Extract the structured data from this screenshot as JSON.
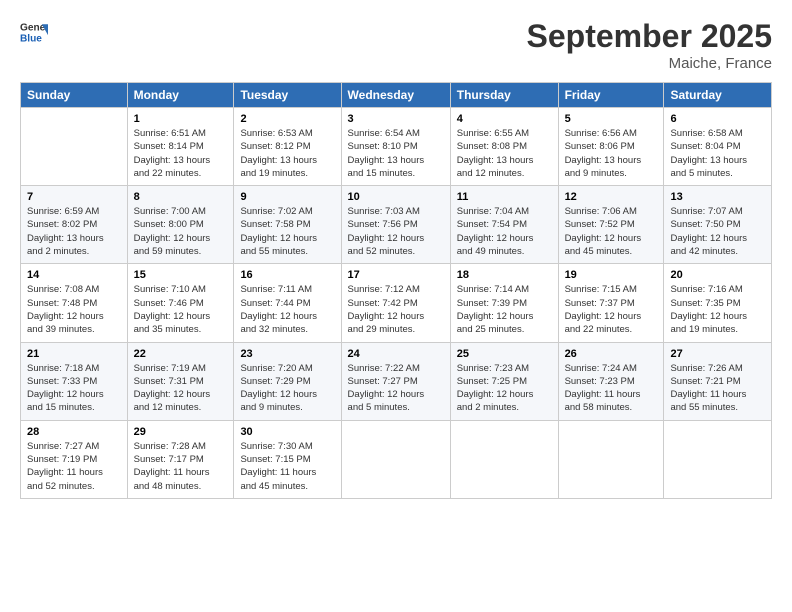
{
  "header": {
    "logo_line1": "General",
    "logo_line2": "Blue",
    "month_title": "September 2025",
    "location": "Maiche, France"
  },
  "columns": [
    "Sunday",
    "Monday",
    "Tuesday",
    "Wednesday",
    "Thursday",
    "Friday",
    "Saturday"
  ],
  "weeks": [
    [
      {
        "day": "",
        "detail": ""
      },
      {
        "day": "1",
        "detail": "Sunrise: 6:51 AM\nSunset: 8:14 PM\nDaylight: 13 hours\nand 22 minutes."
      },
      {
        "day": "2",
        "detail": "Sunrise: 6:53 AM\nSunset: 8:12 PM\nDaylight: 13 hours\nand 19 minutes."
      },
      {
        "day": "3",
        "detail": "Sunrise: 6:54 AM\nSunset: 8:10 PM\nDaylight: 13 hours\nand 15 minutes."
      },
      {
        "day": "4",
        "detail": "Sunrise: 6:55 AM\nSunset: 8:08 PM\nDaylight: 13 hours\nand 12 minutes."
      },
      {
        "day": "5",
        "detail": "Sunrise: 6:56 AM\nSunset: 8:06 PM\nDaylight: 13 hours\nand 9 minutes."
      },
      {
        "day": "6",
        "detail": "Sunrise: 6:58 AM\nSunset: 8:04 PM\nDaylight: 13 hours\nand 5 minutes."
      }
    ],
    [
      {
        "day": "7",
        "detail": "Sunrise: 6:59 AM\nSunset: 8:02 PM\nDaylight: 13 hours\nand 2 minutes."
      },
      {
        "day": "8",
        "detail": "Sunrise: 7:00 AM\nSunset: 8:00 PM\nDaylight: 12 hours\nand 59 minutes."
      },
      {
        "day": "9",
        "detail": "Sunrise: 7:02 AM\nSunset: 7:58 PM\nDaylight: 12 hours\nand 55 minutes."
      },
      {
        "day": "10",
        "detail": "Sunrise: 7:03 AM\nSunset: 7:56 PM\nDaylight: 12 hours\nand 52 minutes."
      },
      {
        "day": "11",
        "detail": "Sunrise: 7:04 AM\nSunset: 7:54 PM\nDaylight: 12 hours\nand 49 minutes."
      },
      {
        "day": "12",
        "detail": "Sunrise: 7:06 AM\nSunset: 7:52 PM\nDaylight: 12 hours\nand 45 minutes."
      },
      {
        "day": "13",
        "detail": "Sunrise: 7:07 AM\nSunset: 7:50 PM\nDaylight: 12 hours\nand 42 minutes."
      }
    ],
    [
      {
        "day": "14",
        "detail": "Sunrise: 7:08 AM\nSunset: 7:48 PM\nDaylight: 12 hours\nand 39 minutes."
      },
      {
        "day": "15",
        "detail": "Sunrise: 7:10 AM\nSunset: 7:46 PM\nDaylight: 12 hours\nand 35 minutes."
      },
      {
        "day": "16",
        "detail": "Sunrise: 7:11 AM\nSunset: 7:44 PM\nDaylight: 12 hours\nand 32 minutes."
      },
      {
        "day": "17",
        "detail": "Sunrise: 7:12 AM\nSunset: 7:42 PM\nDaylight: 12 hours\nand 29 minutes."
      },
      {
        "day": "18",
        "detail": "Sunrise: 7:14 AM\nSunset: 7:39 PM\nDaylight: 12 hours\nand 25 minutes."
      },
      {
        "day": "19",
        "detail": "Sunrise: 7:15 AM\nSunset: 7:37 PM\nDaylight: 12 hours\nand 22 minutes."
      },
      {
        "day": "20",
        "detail": "Sunrise: 7:16 AM\nSunset: 7:35 PM\nDaylight: 12 hours\nand 19 minutes."
      }
    ],
    [
      {
        "day": "21",
        "detail": "Sunrise: 7:18 AM\nSunset: 7:33 PM\nDaylight: 12 hours\nand 15 minutes."
      },
      {
        "day": "22",
        "detail": "Sunrise: 7:19 AM\nSunset: 7:31 PM\nDaylight: 12 hours\nand 12 minutes."
      },
      {
        "day": "23",
        "detail": "Sunrise: 7:20 AM\nSunset: 7:29 PM\nDaylight: 12 hours\nand 9 minutes."
      },
      {
        "day": "24",
        "detail": "Sunrise: 7:22 AM\nSunset: 7:27 PM\nDaylight: 12 hours\nand 5 minutes."
      },
      {
        "day": "25",
        "detail": "Sunrise: 7:23 AM\nSunset: 7:25 PM\nDaylight: 12 hours\nand 2 minutes."
      },
      {
        "day": "26",
        "detail": "Sunrise: 7:24 AM\nSunset: 7:23 PM\nDaylight: 11 hours\nand 58 minutes."
      },
      {
        "day": "27",
        "detail": "Sunrise: 7:26 AM\nSunset: 7:21 PM\nDaylight: 11 hours\nand 55 minutes."
      }
    ],
    [
      {
        "day": "28",
        "detail": "Sunrise: 7:27 AM\nSunset: 7:19 PM\nDaylight: 11 hours\nand 52 minutes."
      },
      {
        "day": "29",
        "detail": "Sunrise: 7:28 AM\nSunset: 7:17 PM\nDaylight: 11 hours\nand 48 minutes."
      },
      {
        "day": "30",
        "detail": "Sunrise: 7:30 AM\nSunset: 7:15 PM\nDaylight: 11 hours\nand 45 minutes."
      },
      {
        "day": "",
        "detail": ""
      },
      {
        "day": "",
        "detail": ""
      },
      {
        "day": "",
        "detail": ""
      },
      {
        "day": "",
        "detail": ""
      }
    ]
  ]
}
